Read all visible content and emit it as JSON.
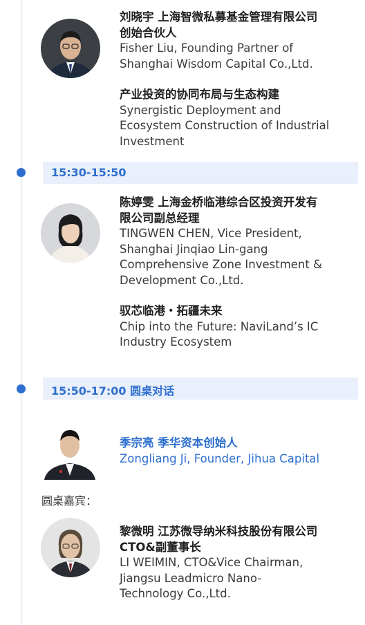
{
  "speaker1": {
    "name_cn_lines": [
      "刘晓宇 上海智微私募基金管理有限公司",
      "创始合伙人"
    ],
    "name_en_lines": [
      "Fisher Liu, Founding Partner of",
      "Shanghai Wisdom Capital Co.,Ltd."
    ],
    "topic_cn": "产业投资的协同布局与生态构建",
    "topic_en_lines": [
      "Synergistic Deployment and",
      "Ecosystem Construction of Industrial",
      "Investment"
    ]
  },
  "session2": {
    "time": "15:30-15:50",
    "speaker": {
      "name_cn_lines": [
        "陈婷雯 上海金桥临港综合区投资开发有",
        "限公司副总经理"
      ],
      "name_en_lines": [
        "TINGWEN CHEN, Vice President,",
        "Shanghai Jinqiao Lin-gang",
        "Comprehensive Zone Investment &",
        "Development Co.,Ltd."
      ],
      "topic_cn": "驭芯临港・拓疆未来",
      "topic_en_lines": [
        "Chip into the Future: NaviLand’s IC",
        "Industry Ecosystem"
      ]
    }
  },
  "session3": {
    "time": "15:50-17:00 圆桌对话",
    "moderator": {
      "name_cn": "季宗亮 季华资本创始人",
      "name_en": "Zongliang Ji, Founder, Jihua Capital"
    },
    "guests_label": "圆桌嘉宾：",
    "guest1": {
      "name_cn_lines": [
        "黎微明 江苏微导纳米科技股份有限公司",
        "CTO&副董事长"
      ],
      "name_en_lines": [
        "LI WEIMIN, CTO&Vice Chairman,",
        "Jiangsu Leadmicro Nano-",
        "Technology Co.,Ltd."
      ]
    }
  },
  "colors": {
    "accent": "#2e6fcf",
    "time_bar_bg": "#e9f0fb",
    "timeline": "#c9d7ea"
  }
}
